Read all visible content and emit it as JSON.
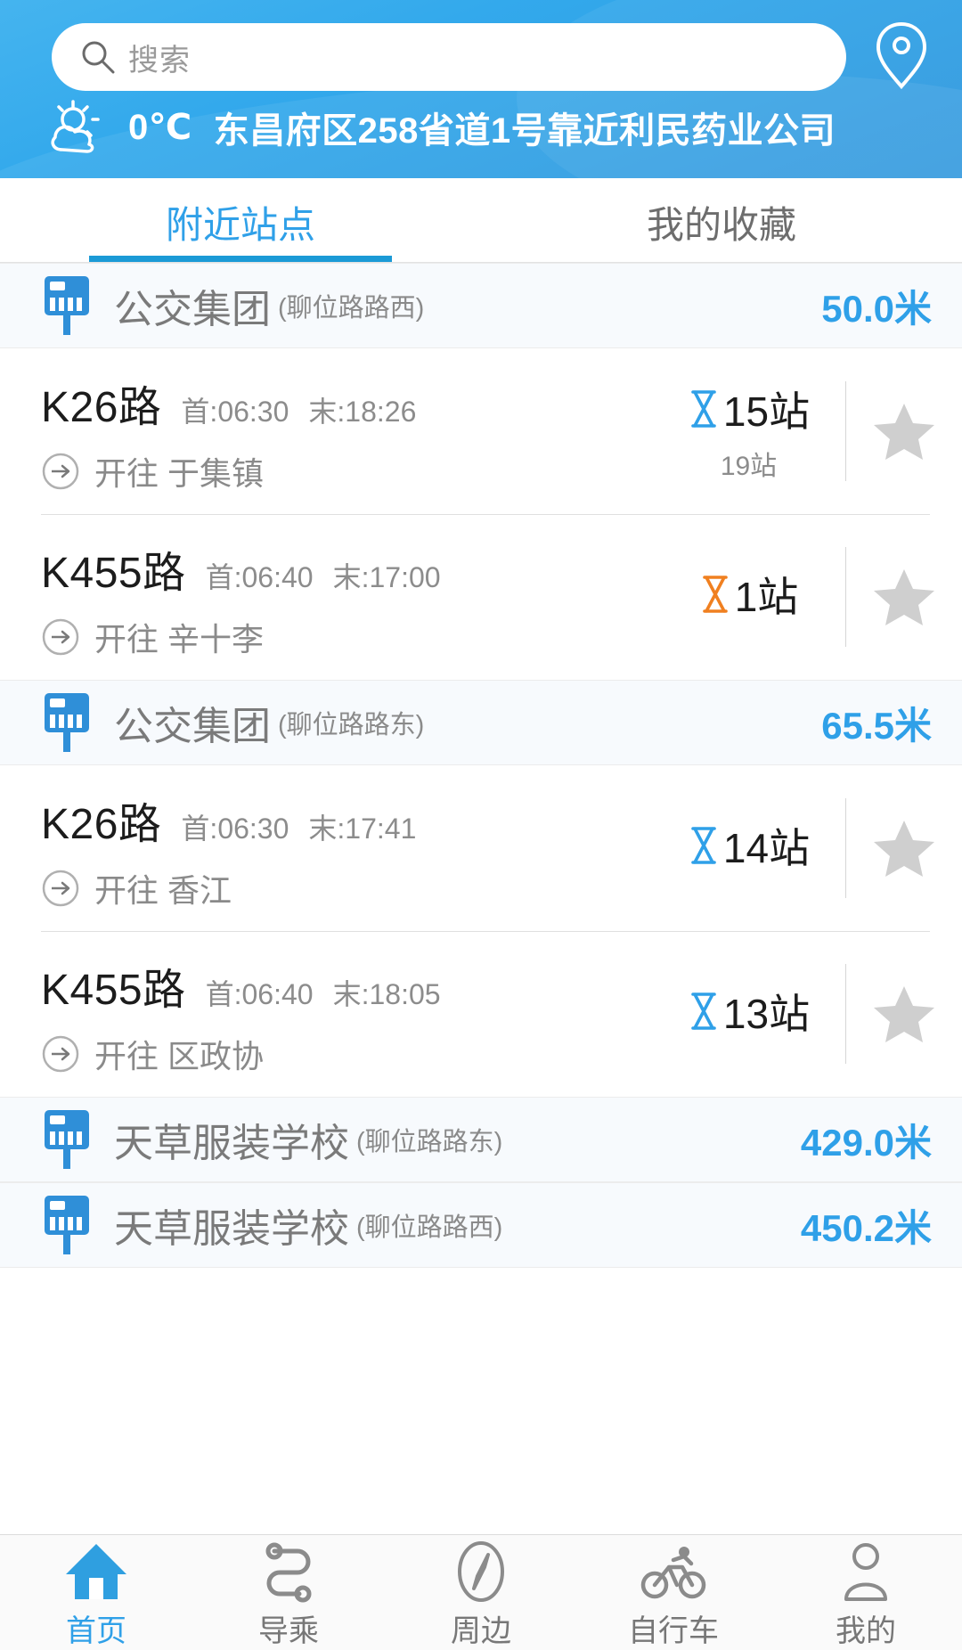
{
  "header": {
    "search": {
      "placeholder": "搜索",
      "icon": "search-icon"
    },
    "location_button_icon": "map-pin-icon",
    "weather": {
      "icon": "sun-cloud-icon",
      "temperature": "0℃",
      "location": "东昌府区258省道1号靠近利民药业公司"
    }
  },
  "tabs": [
    {
      "label": "附近站点",
      "active": true
    },
    {
      "label": "我的收藏",
      "active": false
    }
  ],
  "stations": [
    {
      "name": "公交集团",
      "sub": "(聊位路路西)",
      "distance": "50.0米",
      "routes": [
        {
          "name": "K26路",
          "first_label": "首:06:30",
          "last_label": "末:18:26",
          "eta": "15站",
          "eta_color": "#2fa0e8",
          "eta_second": "19站",
          "dest": "开往 于集镇",
          "favorited": false
        },
        {
          "name": "K455路",
          "first_label": "首:06:40",
          "last_label": "末:17:00",
          "eta": "1站",
          "eta_color": "#f08020",
          "eta_second": "",
          "dest": "开往 辛十李",
          "favorited": false
        }
      ]
    },
    {
      "name": "公交集团",
      "sub": "(聊位路路东)",
      "distance": "65.5米",
      "routes": [
        {
          "name": "K26路",
          "first_label": "首:06:30",
          "last_label": "末:17:41",
          "eta": "14站",
          "eta_color": "#2fa0e8",
          "eta_second": "",
          "dest": "开往 香江",
          "favorited": false
        },
        {
          "name": "K455路",
          "first_label": "首:06:40",
          "last_label": "末:18:05",
          "eta": "13站",
          "eta_color": "#2fa0e8",
          "eta_second": "",
          "dest": "开往 区政协",
          "favorited": false
        }
      ]
    },
    {
      "name": "天草服装学校",
      "sub": "(聊位路路东)",
      "distance": "429.0米",
      "routes": []
    },
    {
      "name": "天草服装学校",
      "sub": "(聊位路路西)",
      "distance": "450.2米",
      "routes": []
    }
  ],
  "bottom_nav": [
    {
      "label": "首页",
      "icon": "home-icon",
      "active": true
    },
    {
      "label": "导乘",
      "icon": "route-icon",
      "active": false
    },
    {
      "label": "周边",
      "icon": "compass-icon",
      "active": false
    },
    {
      "label": "自行车",
      "icon": "bicycle-icon",
      "active": false
    },
    {
      "label": "我的",
      "icon": "person-icon",
      "active": false
    }
  ],
  "colors": {
    "brand_blue": "#2fa0e8",
    "header_blue": "#33a9ec",
    "accent_orange": "#f08020",
    "station_bg": "#f7fafd"
  }
}
